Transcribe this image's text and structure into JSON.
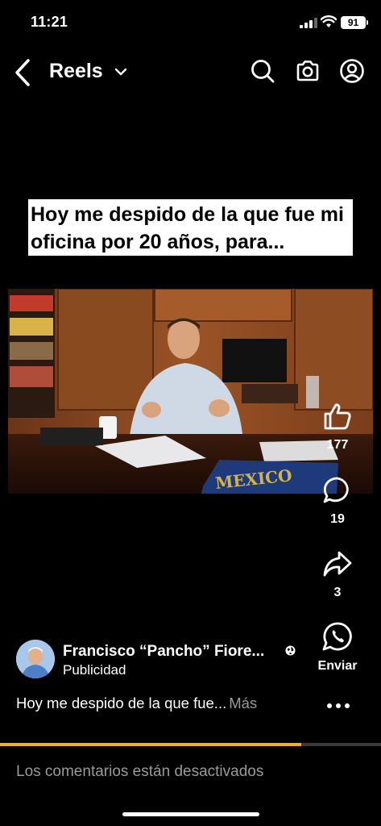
{
  "status_bar": {
    "time": "11:21",
    "battery": "91"
  },
  "header": {
    "title": "Reels",
    "icons": [
      "back-chevron-icon",
      "dropdown-chevron-icon",
      "search-icon",
      "camera-icon",
      "profile-icon"
    ]
  },
  "video": {
    "overlay_caption": "Hoy me despido de la que fue mi oficina por 20 años, para...",
    "book_spine_text": "MEXICO"
  },
  "actions": {
    "like_count": "177",
    "comment_count": "19",
    "share_count": "3",
    "send_label": "Enviar"
  },
  "author": {
    "name": "Francisco “Pancho” Fiore...",
    "sponsored_label": "Publicidad"
  },
  "post": {
    "caption": "Hoy me despido de la que fue...",
    "more_label": "Más"
  },
  "progress": {
    "fraction": 0.79,
    "color": "#f2b01c"
  },
  "comments_disabled_text": "Los comentarios están desactivados"
}
